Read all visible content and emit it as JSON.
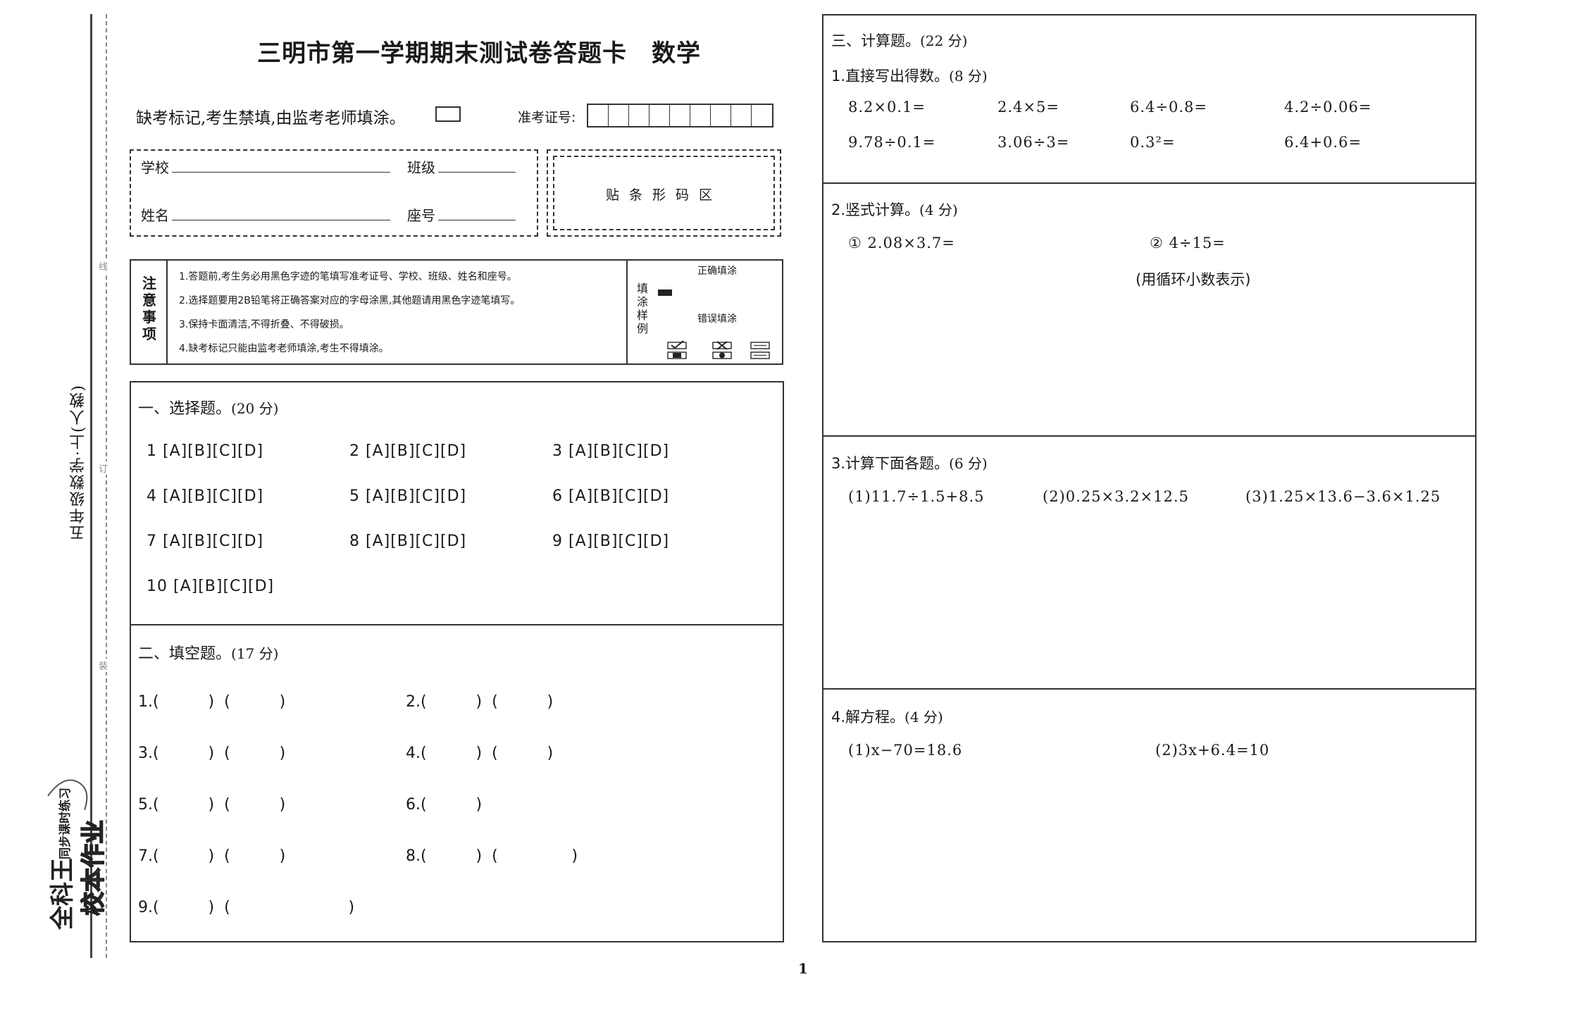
{
  "title": "三明市第一学期期末测试卷答题卡　数学",
  "spine": {
    "subject": "五年级数学·上(人教)",
    "cut_marks": [
      "线",
      "订",
      "装"
    ],
    "brand_line1": "全科王",
    "brand_line2": "同步课时练习",
    "brand_line3": "校本作业"
  },
  "header": {
    "absent_note": "缺考标记,考生禁填,由监考老师填涂。",
    "exam_id_label": "准考证号:",
    "exam_id_cells": 9
  },
  "info": {
    "school": "学校",
    "class": "班级",
    "name": "姓名",
    "seat": "座号",
    "barcode": "贴条形码区"
  },
  "notes": {
    "title": "注意事项",
    "items": [
      "1.答题前,考生务必用黑色字迹的笔填写准考证号、学校、班级、姓名和座号。",
      "2.选择题要用2B铅笔将正确答案对应的字母涂黑,其他题请用黑色字迹笔填写。",
      "3.保持卡面清洁,不得折叠、不得破损。",
      "4.缺考标记只能由监考老师填涂,考生不得填涂。"
    ],
    "sample_title": "填涂样例",
    "correct": "正确填涂",
    "wrong": "错误填涂"
  },
  "section1": {
    "title": "一、选择题。",
    "score": "(20 分)",
    "items": [
      "1 [A][B][C][D]",
      "2 [A][B][C][D]",
      "3 [A][B][C][D]",
      "4 [A][B][C][D]",
      "5 [A][B][C][D]",
      "6 [A][B][C][D]",
      "7 [A][B][C][D]",
      "8 [A][B][C][D]",
      "9 [A][B][C][D]",
      "10 [A][B][C][D]"
    ]
  },
  "section2": {
    "title": "二、填空题。",
    "score": "(17 分)",
    "items": [
      "1.(          )  (          )",
      "2.(          )  (          )",
      "3.(          )  (          )",
      "4.(          )  (          )",
      "5.(          )  (          )",
      "6.(          )",
      "7.(          )  (          )",
      "8.(          )  (               )",
      "9.(          )  (                        )"
    ]
  },
  "section3": {
    "title": "三、计算题。",
    "score": "(22 分)",
    "q1": {
      "title": "1.直接写出得数。",
      "score": "(8 分)",
      "row1": [
        "8.2×0.1=",
        "2.4×5=",
        "6.4÷0.8=",
        "4.2÷0.06="
      ],
      "row2": [
        "9.78÷0.1=",
        "3.06÷3=",
        "0.3²=",
        "6.4+0.6="
      ]
    },
    "q2": {
      "title": "2.竖式计算。",
      "score": "(4 分)",
      "items": [
        "① 2.08×3.7=",
        "② 4÷15="
      ],
      "note": "(用循环小数表示)"
    },
    "q3": {
      "title": "3.计算下面各题。",
      "score": "(6 分)",
      "items": [
        "(1)11.7÷1.5+8.5",
        "(2)0.25×3.2×12.5",
        "(3)1.25×13.6−3.6×1.25"
      ]
    },
    "q4": {
      "title": "4.解方程。",
      "score": "(4 分)",
      "items": [
        "(1)x−70=18.6",
        "(2)3x+6.4=10"
      ]
    }
  },
  "page_number": "1"
}
